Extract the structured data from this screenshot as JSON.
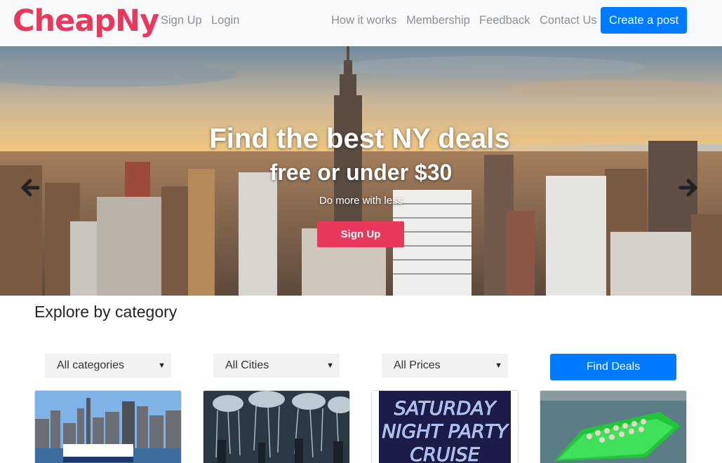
{
  "brand": {
    "logo_text": "CheapNy",
    "accent": "#e8395d",
    "primary": "#007bff"
  },
  "nav": {
    "left_links": [
      "Sign Up",
      "Login"
    ],
    "right_links": [
      "How it works",
      "Membership",
      "Feedback",
      "Contact Us"
    ],
    "create_post_label": "Create a post"
  },
  "hero": {
    "title": "Find the best NY deals",
    "subtitle": "free or under $30",
    "tagline": "Do more with less",
    "signup_label": "Sign Up",
    "prev_icon": "arrow-left-icon",
    "next_icon": "arrow-right-icon"
  },
  "explore": {
    "title": "Explore by category",
    "filters": {
      "category_selected": "All categories",
      "city_selected": "All Cities",
      "price_selected": "All Prices"
    },
    "find_label": "Find Deals"
  },
  "cards": [
    {
      "image": "ny-skyline-ferry"
    },
    {
      "image": "jellyfish-exhibit"
    },
    {
      "image": "saturday-night-party-cruise",
      "image_text": [
        "SATURDAY",
        "NIGHT PARTY",
        "CRUISE"
      ]
    },
    {
      "image": "speedboat-tour"
    }
  ]
}
